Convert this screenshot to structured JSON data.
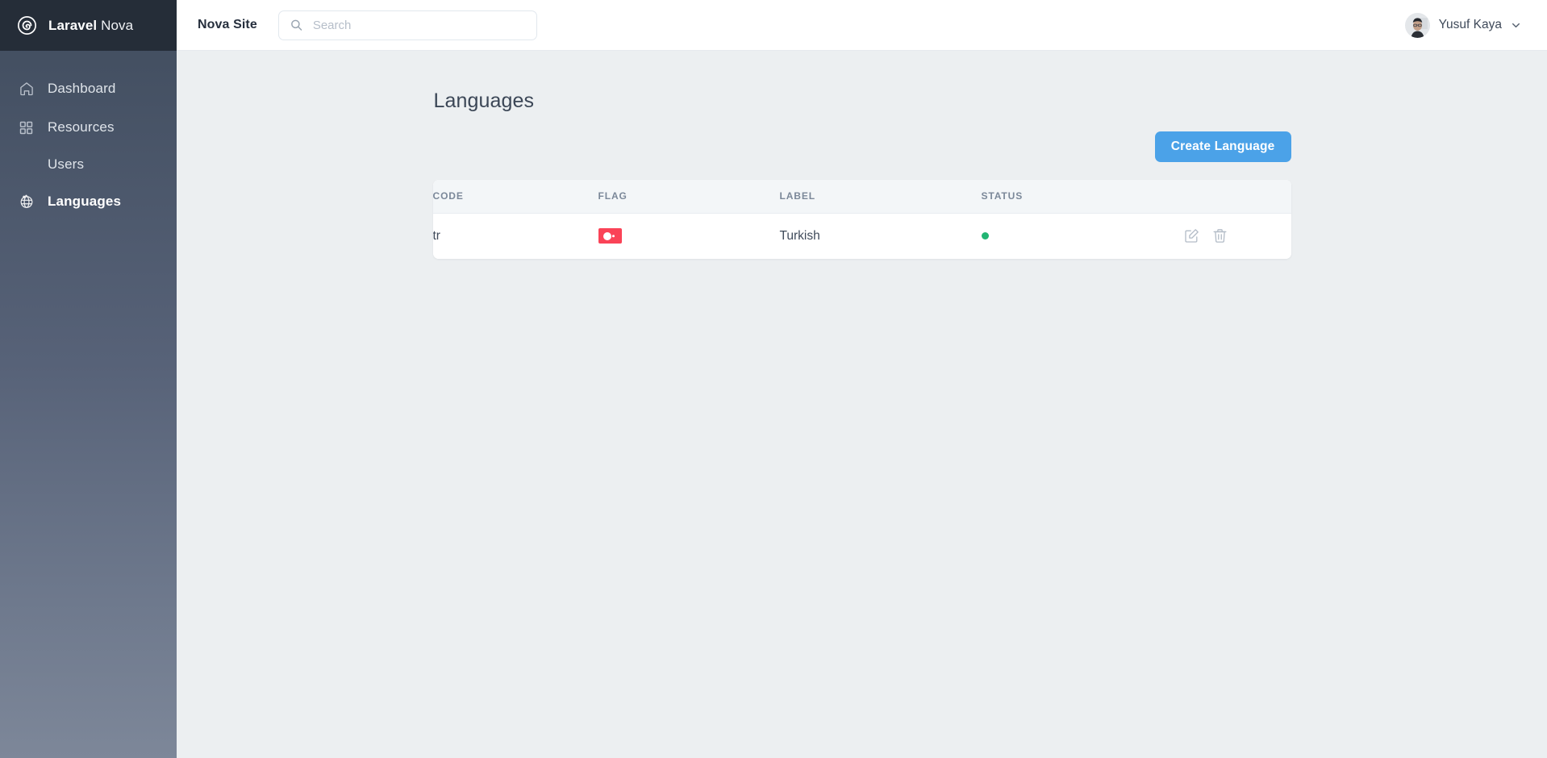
{
  "brand": {
    "logo_icon": "laravel-nova-spiral-icon",
    "name_bold": "Laravel",
    "name_light": "Nova"
  },
  "sidebar": {
    "items": [
      {
        "label": "Dashboard",
        "icon": "home-icon",
        "active": false,
        "sub": false
      },
      {
        "label": "Resources",
        "icon": "grid-icon",
        "active": false,
        "sub": false
      },
      {
        "label": "Users",
        "icon": "",
        "active": false,
        "sub": true
      },
      {
        "label": "Languages",
        "icon": "globe-icon",
        "active": true,
        "sub": false
      }
    ]
  },
  "topbar": {
    "site_name": "Nova Site",
    "search": {
      "placeholder": "Search",
      "value": "",
      "icon": "search-icon"
    },
    "user": {
      "name": "Yusuf Kaya",
      "avatar_alt": "user-avatar-photo",
      "chevron_icon": "chevron-down-icon"
    }
  },
  "page": {
    "title": "Languages",
    "create_button_label": "Create Language"
  },
  "table": {
    "columns": [
      "CODE",
      "FLAG",
      "LABEL",
      "STATUS",
      ""
    ],
    "rows": [
      {
        "code": "tr",
        "flag": "🇹🇷",
        "flag_name": "turkey-flag",
        "label": "Turkish",
        "status": "active",
        "status_color": "#22b573",
        "actions": [
          "edit-icon",
          "delete-icon"
        ]
      }
    ]
  },
  "colors": {
    "accent": "#4ba2e8",
    "sidebar_top": "#434f61",
    "sidebar_bottom": "#7d8799",
    "sidebar_logo_bg": "#252d38",
    "content_bg": "#eceff1",
    "status_active": "#22b573",
    "flag_red": "#fa4357"
  }
}
